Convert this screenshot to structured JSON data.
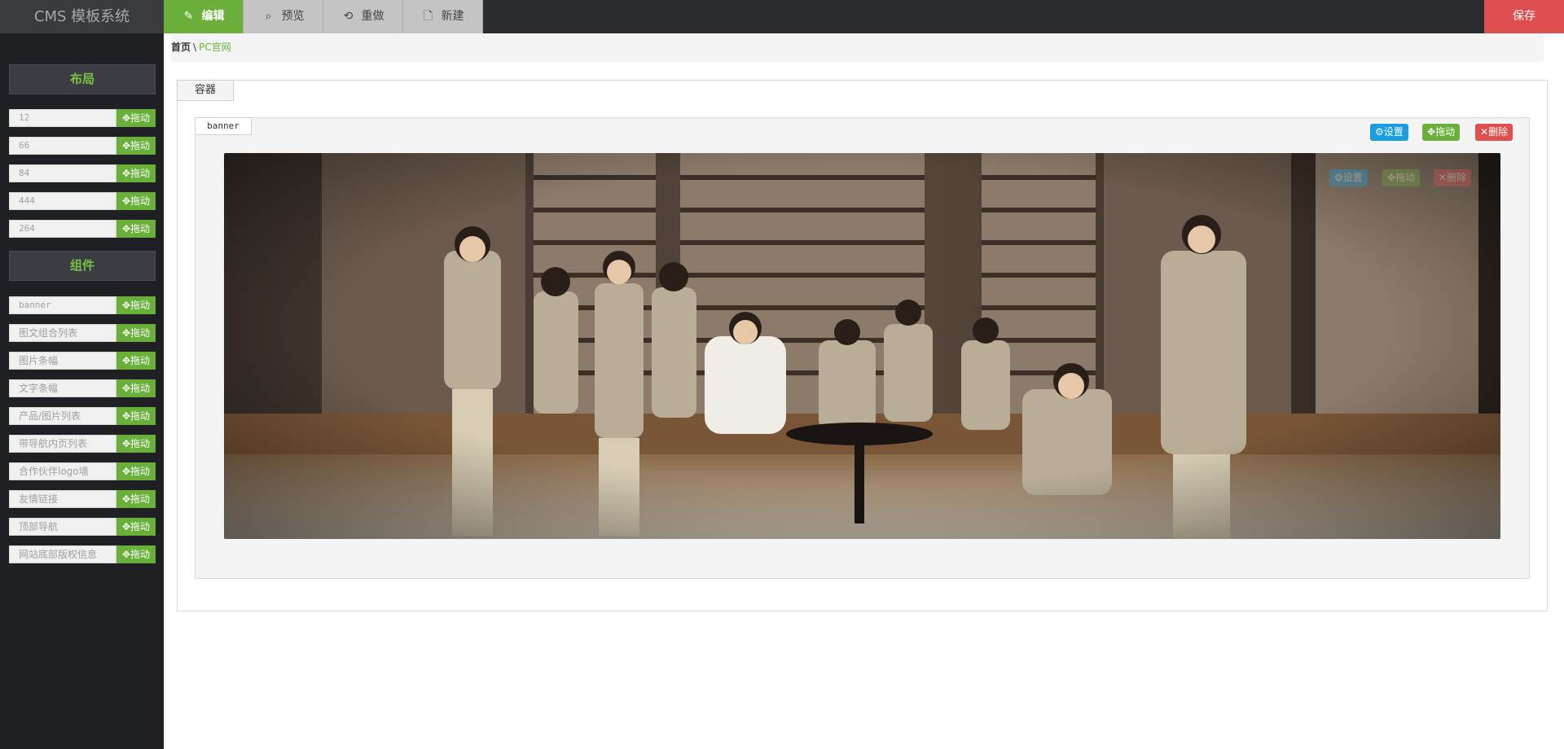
{
  "app": {
    "title": "CMS 模板系统"
  },
  "toolbar": {
    "edit": {
      "icon": "edit-icon",
      "label": "编辑"
    },
    "preview": {
      "icon": "preview-icon",
      "label": "预览"
    },
    "redo": {
      "icon": "undo-icon",
      "label": "重做"
    },
    "new": {
      "icon": "new-file-icon",
      "label": "新建"
    },
    "save": "保存",
    "colors": {
      "active": "#6aaf3a",
      "save": "#e04f4f",
      "bar": "#2b2c2f"
    }
  },
  "sidebar": {
    "layout_title": "布局",
    "layout_items": [
      {
        "label": "12",
        "drag": "拖动"
      },
      {
        "label": "66",
        "drag": "拖动"
      },
      {
        "label": "84",
        "drag": "拖动"
      },
      {
        "label": "444",
        "drag": "拖动"
      },
      {
        "label": "264",
        "drag": "拖动"
      }
    ],
    "component_title": "组件",
    "component_items": [
      {
        "label": "banner",
        "drag": "拖动"
      },
      {
        "label": "图文组合列表",
        "drag": "拖动"
      },
      {
        "label": "图片条幅",
        "drag": "拖动"
      },
      {
        "label": "文字条幅",
        "drag": "拖动"
      },
      {
        "label": "产品/图片列表",
        "drag": "拖动"
      },
      {
        "label": "带导航内页列表",
        "drag": "拖动"
      },
      {
        "label": "合作伙伴logo墙",
        "drag": "拖动"
      },
      {
        "label": "友情链接",
        "drag": "拖动"
      },
      {
        "label": "顶部导航",
        "drag": "拖动"
      },
      {
        "label": "网站底部版权信息",
        "drag": "拖动"
      }
    ]
  },
  "breadcrumb": {
    "home": "首页",
    "separator": "\\",
    "current": "PC官网"
  },
  "container": {
    "tab": "容器",
    "block": {
      "tab": "banner",
      "actions": {
        "settings": "设置",
        "drag": "拖动",
        "delete": "删除"
      },
      "image": {
        "description_icon": "banner-image"
      },
      "overlay_actions": {
        "settings": "设置",
        "drag": "拖动",
        "delete": "删除"
      }
    }
  }
}
